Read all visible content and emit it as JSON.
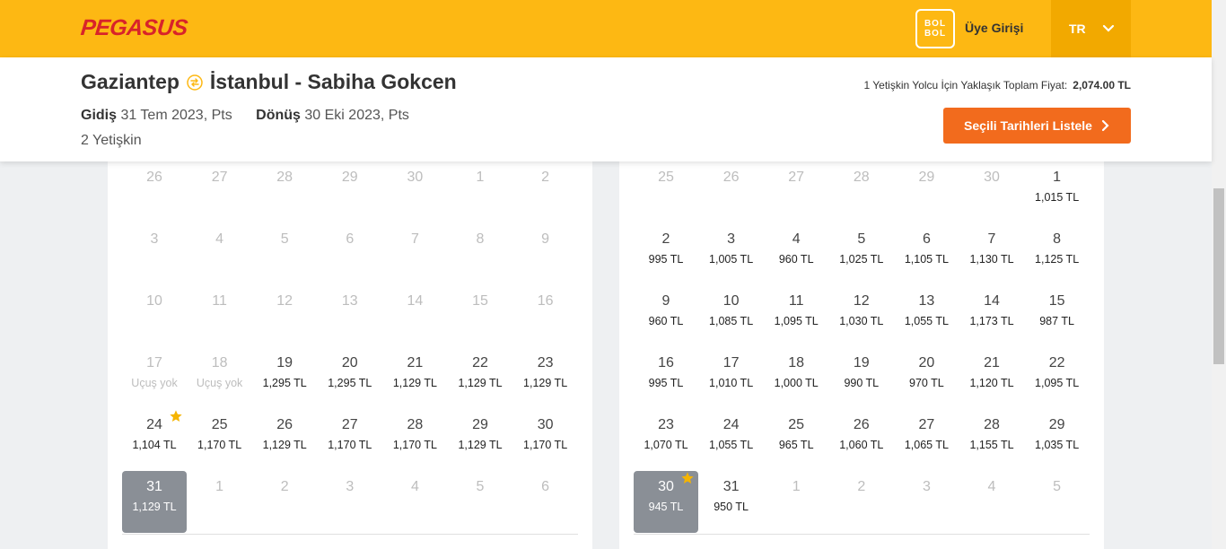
{
  "brand": {
    "logo": "PEGASUS",
    "bolbol_line1": "BOL",
    "bolbol_line2": "BOL"
  },
  "header": {
    "login_label": "Üye Girişi",
    "lang_label": "TR"
  },
  "summary": {
    "origin": "Gaziantep",
    "destination": "İstanbul - Sabiha Gokcen",
    "departure_label": "Gidiş",
    "departure_date": "31 Tem 2023, Pts",
    "return_label": "Dönüş",
    "return_date": "30 Eki 2023, Pts",
    "passengers": "2 Yetişkin",
    "total_label": "1 Yetişkin Yolcu İçin Yaklaşık Toplam Fiyat:",
    "total_value": "2,074.00 TL",
    "list_button": "Seçili Tarihleri Listele"
  },
  "colors": {
    "brand_yellow": "#fdb813",
    "brand_red": "#d8232a",
    "cta_orange": "#f26b1d",
    "selected_gray": "#8a8f96",
    "star": "#f5b400"
  },
  "calendars": [
    {
      "rows": [
        [
          {
            "day": "26",
            "muted": true
          },
          {
            "day": "27",
            "muted": true
          },
          {
            "day": "28",
            "muted": true
          },
          {
            "day": "29",
            "muted": true
          },
          {
            "day": "30",
            "muted": true
          },
          {
            "day": "1",
            "muted": true
          },
          {
            "day": "2",
            "muted": true
          }
        ],
        [
          {
            "day": "3",
            "muted": true
          },
          {
            "day": "4",
            "muted": true
          },
          {
            "day": "5",
            "muted": true
          },
          {
            "day": "6",
            "muted": true
          },
          {
            "day": "7",
            "muted": true
          },
          {
            "day": "8",
            "muted": true
          },
          {
            "day": "9",
            "muted": true
          }
        ],
        [
          {
            "day": "10",
            "muted": true
          },
          {
            "day": "11",
            "muted": true
          },
          {
            "day": "12",
            "muted": true
          },
          {
            "day": "13",
            "muted": true
          },
          {
            "day": "14",
            "muted": true
          },
          {
            "day": "15",
            "muted": true
          },
          {
            "day": "16",
            "muted": true
          }
        ],
        [
          {
            "day": "17",
            "price": "Uçuş yok",
            "muted": true
          },
          {
            "day": "18",
            "price": "Uçuş yok",
            "muted": true
          },
          {
            "day": "19",
            "price": "1,295 TL"
          },
          {
            "day": "20",
            "price": "1,295 TL"
          },
          {
            "day": "21",
            "price": "1,129 TL"
          },
          {
            "day": "22",
            "price": "1,129 TL"
          },
          {
            "day": "23",
            "price": "1,129 TL"
          }
        ],
        [
          {
            "day": "24",
            "price": "1,104 TL",
            "star": true
          },
          {
            "day": "25",
            "price": "1,170 TL"
          },
          {
            "day": "26",
            "price": "1,129 TL"
          },
          {
            "day": "27",
            "price": "1,170 TL"
          },
          {
            "day": "28",
            "price": "1,170 TL"
          },
          {
            "day": "29",
            "price": "1,129 TL"
          },
          {
            "day": "30",
            "price": "1,170 TL"
          }
        ],
        [
          {
            "day": "31",
            "price": "1,129 TL",
            "selected": true
          },
          {
            "day": "1",
            "muted": true
          },
          {
            "day": "2",
            "muted": true
          },
          {
            "day": "3",
            "muted": true
          },
          {
            "day": "4",
            "muted": true
          },
          {
            "day": "5",
            "muted": true
          },
          {
            "day": "6",
            "muted": true
          }
        ]
      ]
    },
    {
      "rows": [
        [
          {
            "day": "25",
            "muted": true
          },
          {
            "day": "26",
            "muted": true
          },
          {
            "day": "27",
            "muted": true
          },
          {
            "day": "28",
            "muted": true
          },
          {
            "day": "29",
            "muted": true
          },
          {
            "day": "30",
            "muted": true
          },
          {
            "day": "1",
            "price": "1,015 TL"
          }
        ],
        [
          {
            "day": "2",
            "price": "995 TL"
          },
          {
            "day": "3",
            "price": "1,005 TL"
          },
          {
            "day": "4",
            "price": "960 TL"
          },
          {
            "day": "5",
            "price": "1,025 TL"
          },
          {
            "day": "6",
            "price": "1,105 TL"
          },
          {
            "day": "7",
            "price": "1,130 TL"
          },
          {
            "day": "8",
            "price": "1,125 TL"
          }
        ],
        [
          {
            "day": "9",
            "price": "960 TL"
          },
          {
            "day": "10",
            "price": "1,085 TL"
          },
          {
            "day": "11",
            "price": "1,095 TL"
          },
          {
            "day": "12",
            "price": "1,030 TL"
          },
          {
            "day": "13",
            "price": "1,055 TL"
          },
          {
            "day": "14",
            "price": "1,173 TL"
          },
          {
            "day": "15",
            "price": "987 TL"
          }
        ],
        [
          {
            "day": "16",
            "price": "995 TL"
          },
          {
            "day": "17",
            "price": "1,010 TL"
          },
          {
            "day": "18",
            "price": "1,000 TL"
          },
          {
            "day": "19",
            "price": "990 TL"
          },
          {
            "day": "20",
            "price": "970 TL"
          },
          {
            "day": "21",
            "price": "1,120 TL"
          },
          {
            "day": "22",
            "price": "1,095 TL"
          }
        ],
        [
          {
            "day": "23",
            "price": "1,070 TL"
          },
          {
            "day": "24",
            "price": "1,055 TL"
          },
          {
            "day": "25",
            "price": "965 TL"
          },
          {
            "day": "26",
            "price": "1,060 TL"
          },
          {
            "day": "27",
            "price": "1,065 TL"
          },
          {
            "day": "28",
            "price": "1,155 TL"
          },
          {
            "day": "29",
            "price": "1,035 TL"
          }
        ],
        [
          {
            "day": "30",
            "price": "945 TL",
            "selected": true,
            "star": true
          },
          {
            "day": "31",
            "price": "950 TL"
          },
          {
            "day": "1",
            "muted": true
          },
          {
            "day": "2",
            "muted": true
          },
          {
            "day": "3",
            "muted": true
          },
          {
            "day": "4",
            "muted": true
          },
          {
            "day": "5",
            "muted": true
          }
        ]
      ]
    }
  ]
}
